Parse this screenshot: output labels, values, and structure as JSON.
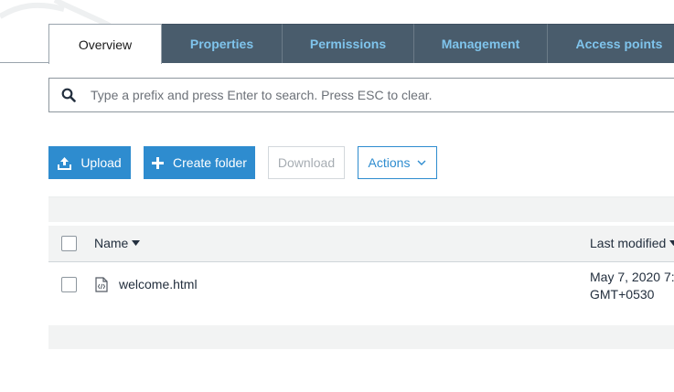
{
  "tabs": [
    {
      "label": "Overview",
      "active": true
    },
    {
      "label": "Properties",
      "active": false
    },
    {
      "label": "Permissions",
      "active": false
    },
    {
      "label": "Management",
      "active": false
    },
    {
      "label": "Access points",
      "active": false
    }
  ],
  "search": {
    "placeholder": "Type a prefix and press Enter to search. Press ESC to clear.",
    "value": ""
  },
  "toolbar": {
    "upload_label": "Upload",
    "create_folder_label": "Create folder",
    "download_label": "Download",
    "actions_label": "Actions"
  },
  "table": {
    "columns": {
      "name": "Name",
      "last_modified": "Last modified"
    },
    "rows": [
      {
        "name": "welcome.html",
        "last_modified_line1": "May 7, 2020 7:",
        "last_modified_line2": "GMT+0530"
      }
    ]
  },
  "colors": {
    "tab_bg": "#495c6c",
    "tab_text": "#7fc4ec",
    "primary": "#2e8ccf",
    "disabled_text": "#a7adb3",
    "band": "#f2f3f3"
  },
  "icons": {
    "search": "search-icon",
    "upload": "upload-icon",
    "create_folder": "plus-icon",
    "actions_menu": "chevron-down-icon",
    "sort": "caret-down-icon",
    "file": "html-file-icon"
  }
}
